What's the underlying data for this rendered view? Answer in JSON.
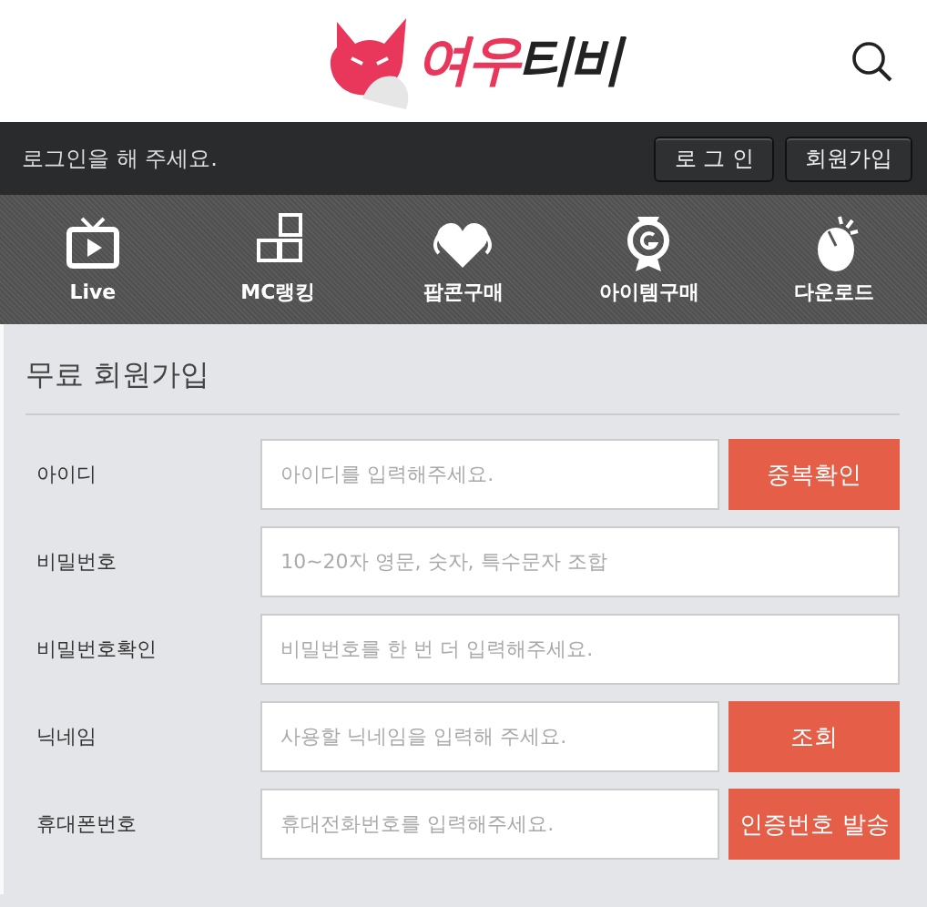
{
  "header": {
    "logo_parts": [
      {
        "text": "여우",
        "color": "#e8375a"
      },
      {
        "text": "티비",
        "color": "#222222"
      }
    ]
  },
  "login_bar": {
    "message": "로그인을 해 주세요.",
    "buttons": [
      "로 그 인",
      "회원가입"
    ]
  },
  "nav": [
    {
      "label": "Live",
      "kind": "tv"
    },
    {
      "label": "MC랭킹",
      "kind": "ranking"
    },
    {
      "label": "팝콘구매",
      "kind": "heart"
    },
    {
      "label": "아이템구매",
      "kind": "medal"
    },
    {
      "label": "다운로드",
      "kind": "mouse"
    }
  ],
  "form": {
    "title": "무료 회원가입",
    "rows": [
      {
        "label": "아이디",
        "placeholder": "아이디를 입력해주세요.",
        "button": "중복확인"
      },
      {
        "label": "비밀번호",
        "placeholder": "10~20자 영문, 숫자, 특수문자 조합"
      },
      {
        "label": "비밀번호확인",
        "placeholder": "비밀번호를 한 번 더 입력해주세요."
      },
      {
        "label": "닉네임",
        "placeholder": "사용할 닉네임을 입력해 주세요.",
        "button": "조회"
      },
      {
        "label": "휴대폰번호",
        "placeholder": "휴대전화번호를 입력해주세요.",
        "button": "인증번호 발송"
      }
    ]
  }
}
